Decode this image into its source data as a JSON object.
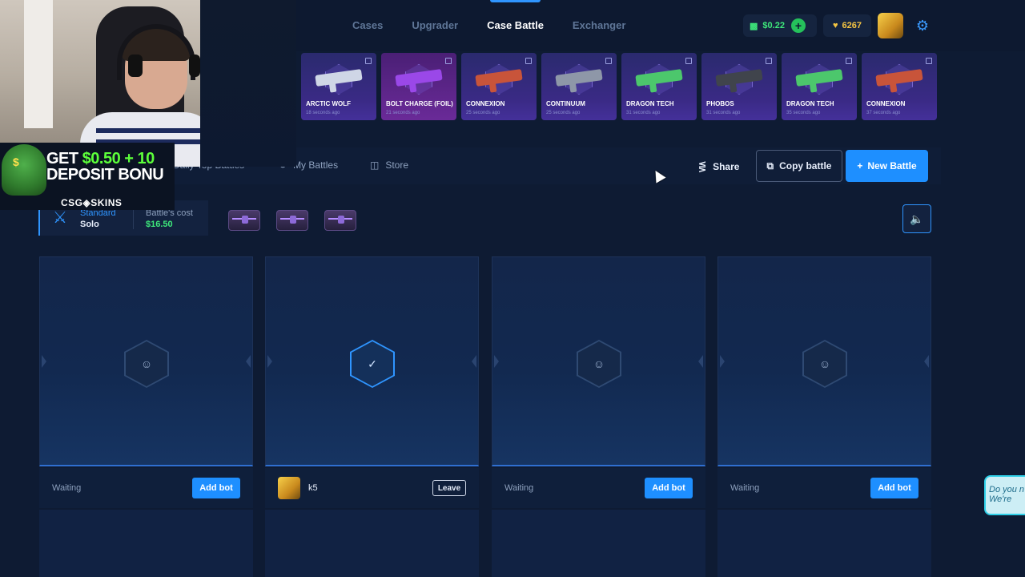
{
  "nav": {
    "tabs": [
      {
        "label": "Cases"
      },
      {
        "label": "Upgrader"
      },
      {
        "label": "Case Battle",
        "active": true
      },
      {
        "label": "Exchanger"
      }
    ],
    "balance": "$0.22",
    "coins": "6267"
  },
  "drops": [
    {
      "name": "ARCTIC WOLF",
      "time": "18 seconds ago",
      "gun_color": "#cfd6e6"
    },
    {
      "name": "BOLT CHARGE (FOIL)",
      "time": "21 seconds ago",
      "gun_color": "#9a48e8"
    },
    {
      "name": "CONNEXION",
      "time": "25 seconds ago",
      "gun_color": "#c8543a"
    },
    {
      "name": "CONTINUUM",
      "time": "25 seconds ago",
      "gun_color": "#8e97a8"
    },
    {
      "name": "DRAGON TECH",
      "time": "31 seconds ago",
      "gun_color": "#4cc76c"
    },
    {
      "name": "PHOBOS",
      "time": "31 seconds ago",
      "gun_color": "#40444c"
    },
    {
      "name": "DRAGON TECH",
      "time": "35 seconds ago",
      "gun_color": "#4cc76c"
    },
    {
      "name": "CONNEXION",
      "time": "37 seconds ago",
      "gun_color": "#c8543a"
    }
  ],
  "subnav": {
    "daily_top": "Daily Top Battles",
    "my_battles": "My Battles",
    "store": "Store",
    "share": "Share",
    "copy": "Copy battle",
    "new": "New Battle"
  },
  "battle": {
    "mode_type": "Standard",
    "mode_sub": "Solo",
    "cost_label": "Battle's cost",
    "cost": "$16.50",
    "case_count": 3
  },
  "slots": [
    {
      "status": "Waiting",
      "action": "Add bot",
      "ready": false
    },
    {
      "player": "k5",
      "action": "Leave",
      "ready": true
    },
    {
      "status": "Waiting",
      "action": "Add bot",
      "ready": false
    },
    {
      "status": "Waiting",
      "action": "Add bot",
      "ready": false
    }
  ],
  "promo": {
    "line1_pre": "GET ",
    "line1_highlight": "$0.50 + 10",
    "line2": "DEPOSIT BONU",
    "brand": "CSG◈SKINS"
  },
  "chat": {
    "text": "Do you n We're"
  },
  "colors": {
    "accent": "#1e8fff",
    "money": "#3ee87b",
    "gold": "#f5c542"
  }
}
